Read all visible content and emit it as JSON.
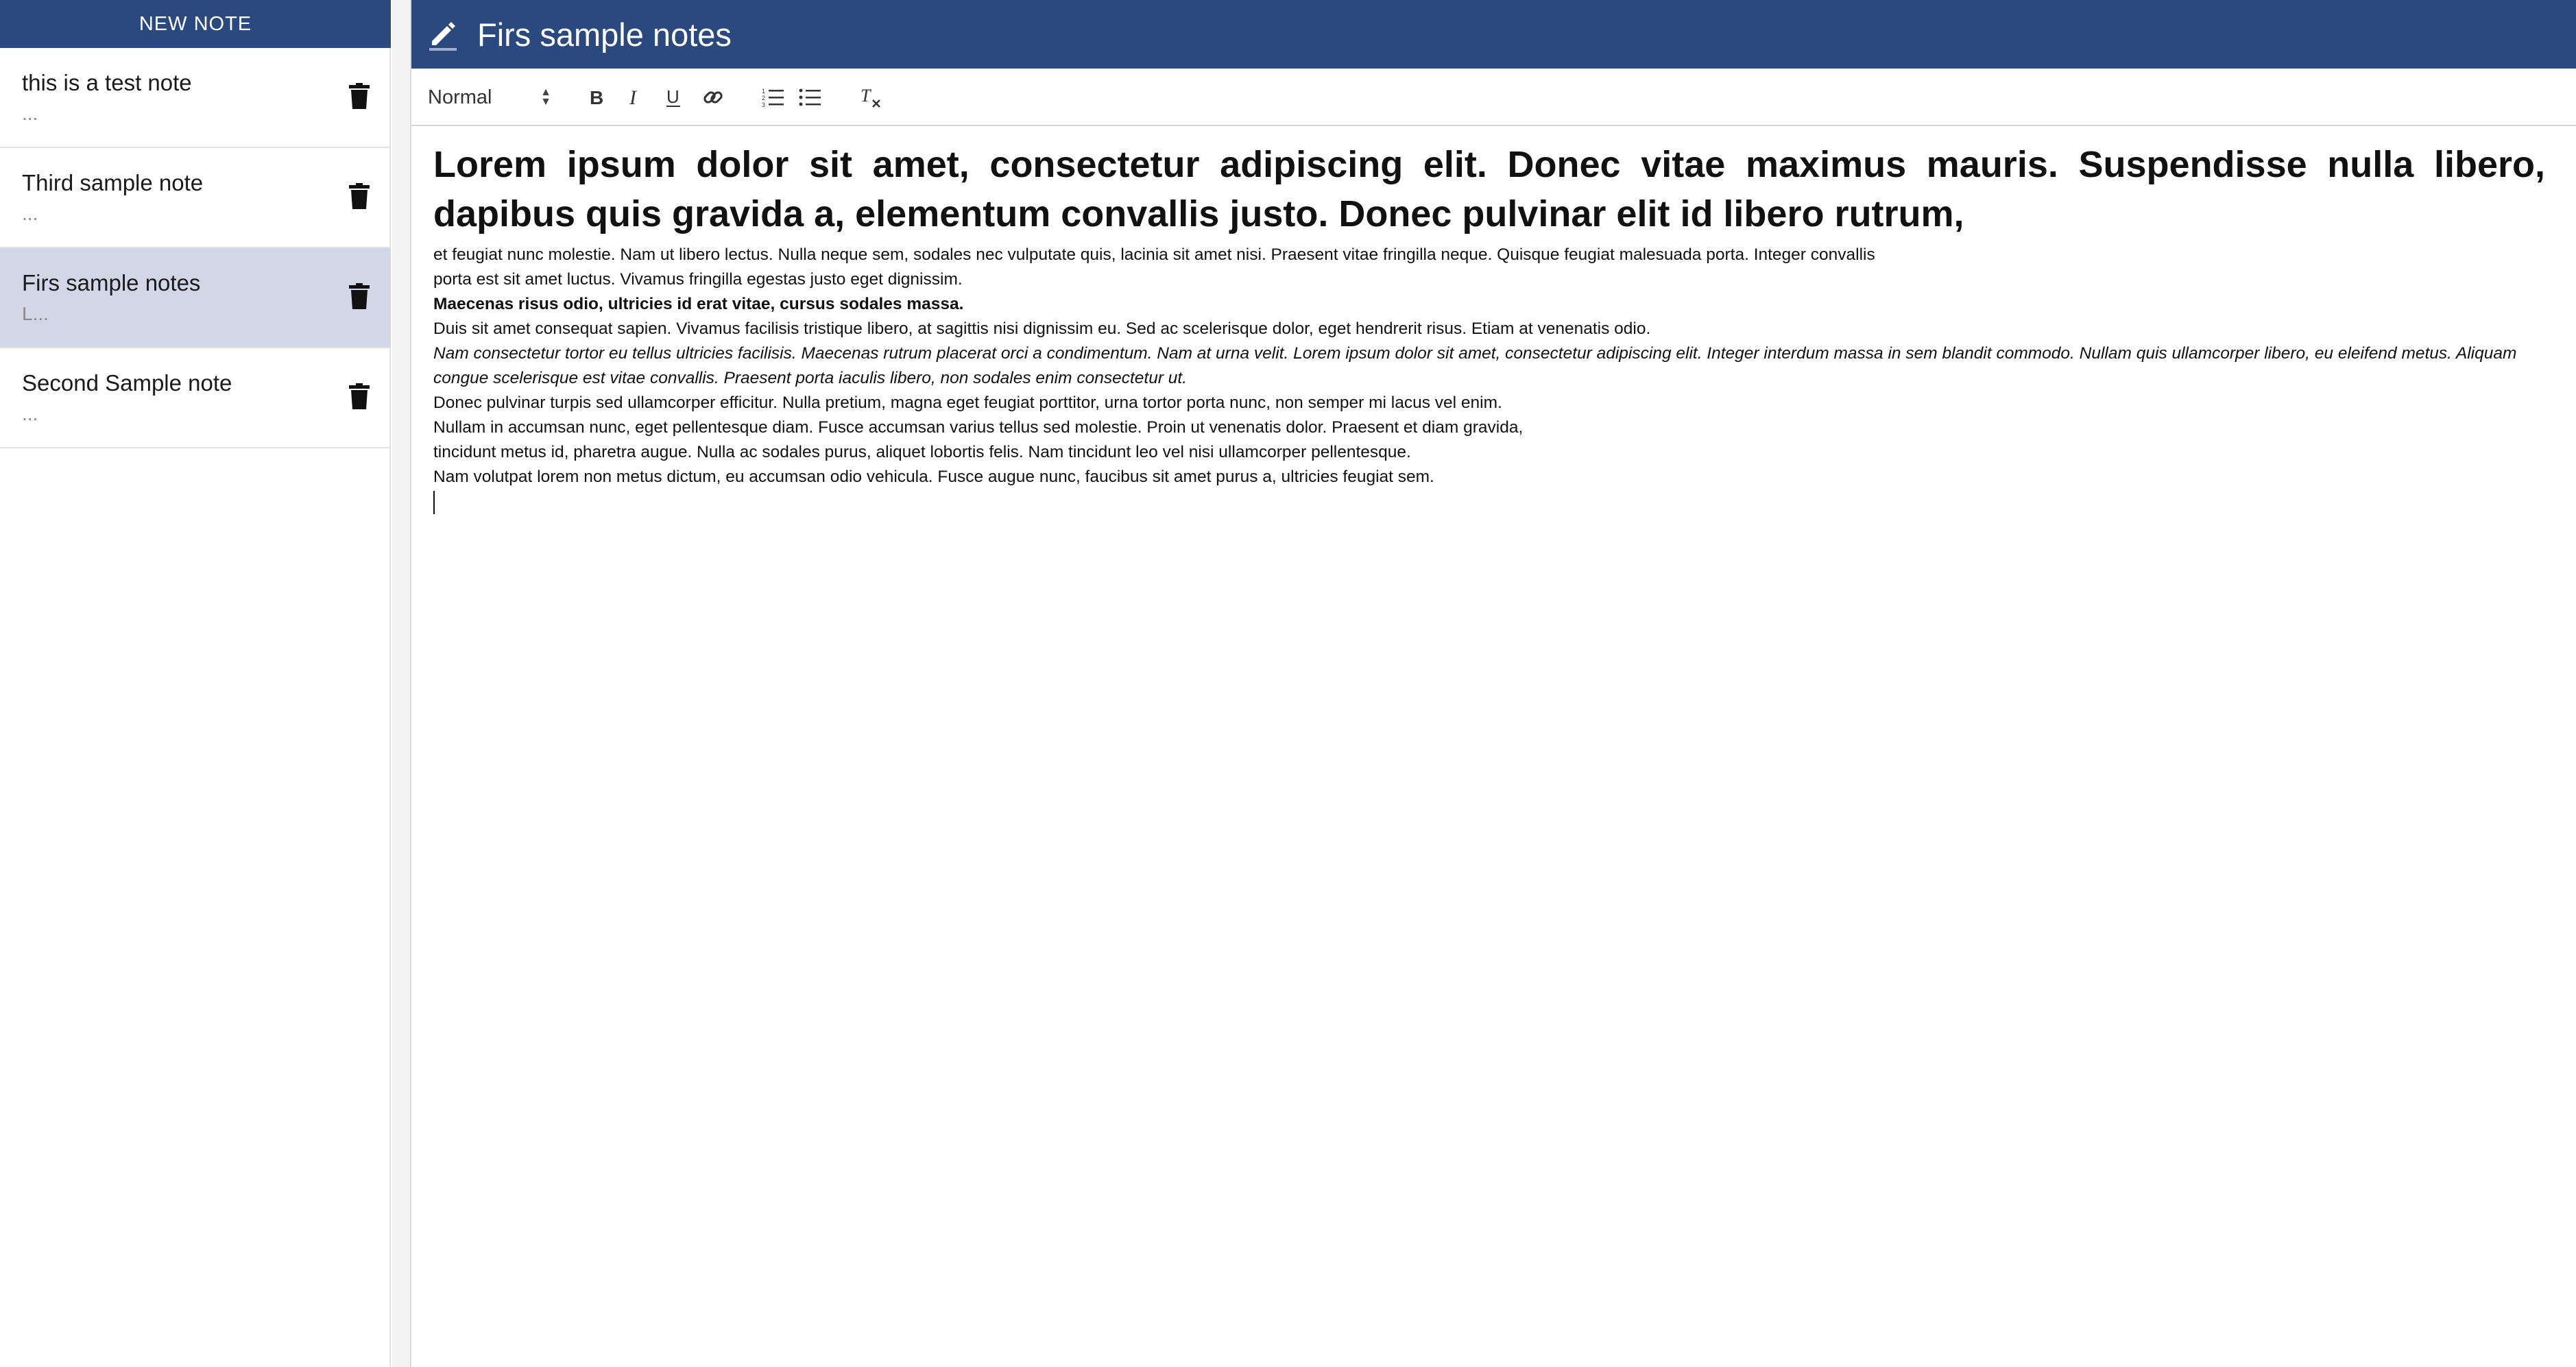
{
  "sidebar": {
    "new_note_label": "NEW NOTE",
    "notes": [
      {
        "title": "this is a test note",
        "preview": "...",
        "selected": false
      },
      {
        "title": "Third sample note",
        "preview": "...",
        "selected": false
      },
      {
        "title": "Firs sample notes",
        "preview": "L...",
        "selected": true
      },
      {
        "title": "Second Sample note",
        "preview": "...",
        "selected": false
      }
    ]
  },
  "header": {
    "title": "Firs sample notes",
    "icon": "pencil-icon"
  },
  "toolbar": {
    "format_value": "Normal",
    "buttons": [
      "bold-icon",
      "italic-icon",
      "underline-icon",
      "link-icon",
      "ordered-list-icon",
      "bullet-list-icon",
      "clear-format-icon"
    ]
  },
  "editor": {
    "heading": "Lorem ipsum dolor sit amet, consectetur adipiscing elit. Donec vitae maximus mauris. Suspendisse nulla libero, dapibus quis gravida a, elementum convallis justo. Donec pulvinar elit id libero rutrum,",
    "line1": "et feugiat nunc molestie. Nam ut libero lectus. Nulla neque sem, sodales nec vulputate quis, lacinia sit amet nisi. Praesent vitae fringilla neque. Quisque feugiat malesuada porta. Integer convallis",
    "line2": "porta est sit amet luctus. Vivamus fringilla egestas justo eget dignissim.",
    "line3": "Maecenas risus odio, ultricies id erat vitae, cursus sodales massa.",
    "line4": "Duis sit amet consequat sapien. Vivamus facilisis tristique libero, at sagittis nisi dignissim eu. Sed ac scelerisque dolor, eget hendrerit risus. Etiam at venenatis odio.",
    "line5": "Nam consectetur tortor eu tellus ultricies facilisis. Maecenas rutrum placerat orci a condimentum. Nam at urna velit. Lorem ipsum dolor sit amet, consectetur adipiscing elit. Integer interdum massa in sem blandit commodo. Nullam quis ullamcorper libero, eu eleifend metus. Aliquam congue scelerisque est vitae convallis. Praesent porta iaculis libero, non sodales enim consectetur ut.",
    "line6": " Donec pulvinar turpis sed ullamcorper efficitur. Nulla pretium, magna eget feugiat porttitor, urna tortor porta nunc, non semper mi lacus vel enim.",
    "line7": "Nullam in accumsan nunc, eget pellentesque diam. Fusce accumsan varius tellus sed molestie. Proin ut venenatis dolor. Praesent et diam gravida,",
    "line8": " tincidunt metus id, pharetra augue. Nulla ac sodales purus, aliquet lobortis felis. Nam tincidunt leo vel nisi ullamcorper pellentesque.",
    "line9": "Nam volutpat lorem non metus dictum, eu accumsan odio vehicula. Fusce augue nunc, faucibus sit amet purus a, ultricies feugiat sem."
  },
  "colors": {
    "brand": "#29497f",
    "selected_note_bg": "#d3d6e6"
  }
}
